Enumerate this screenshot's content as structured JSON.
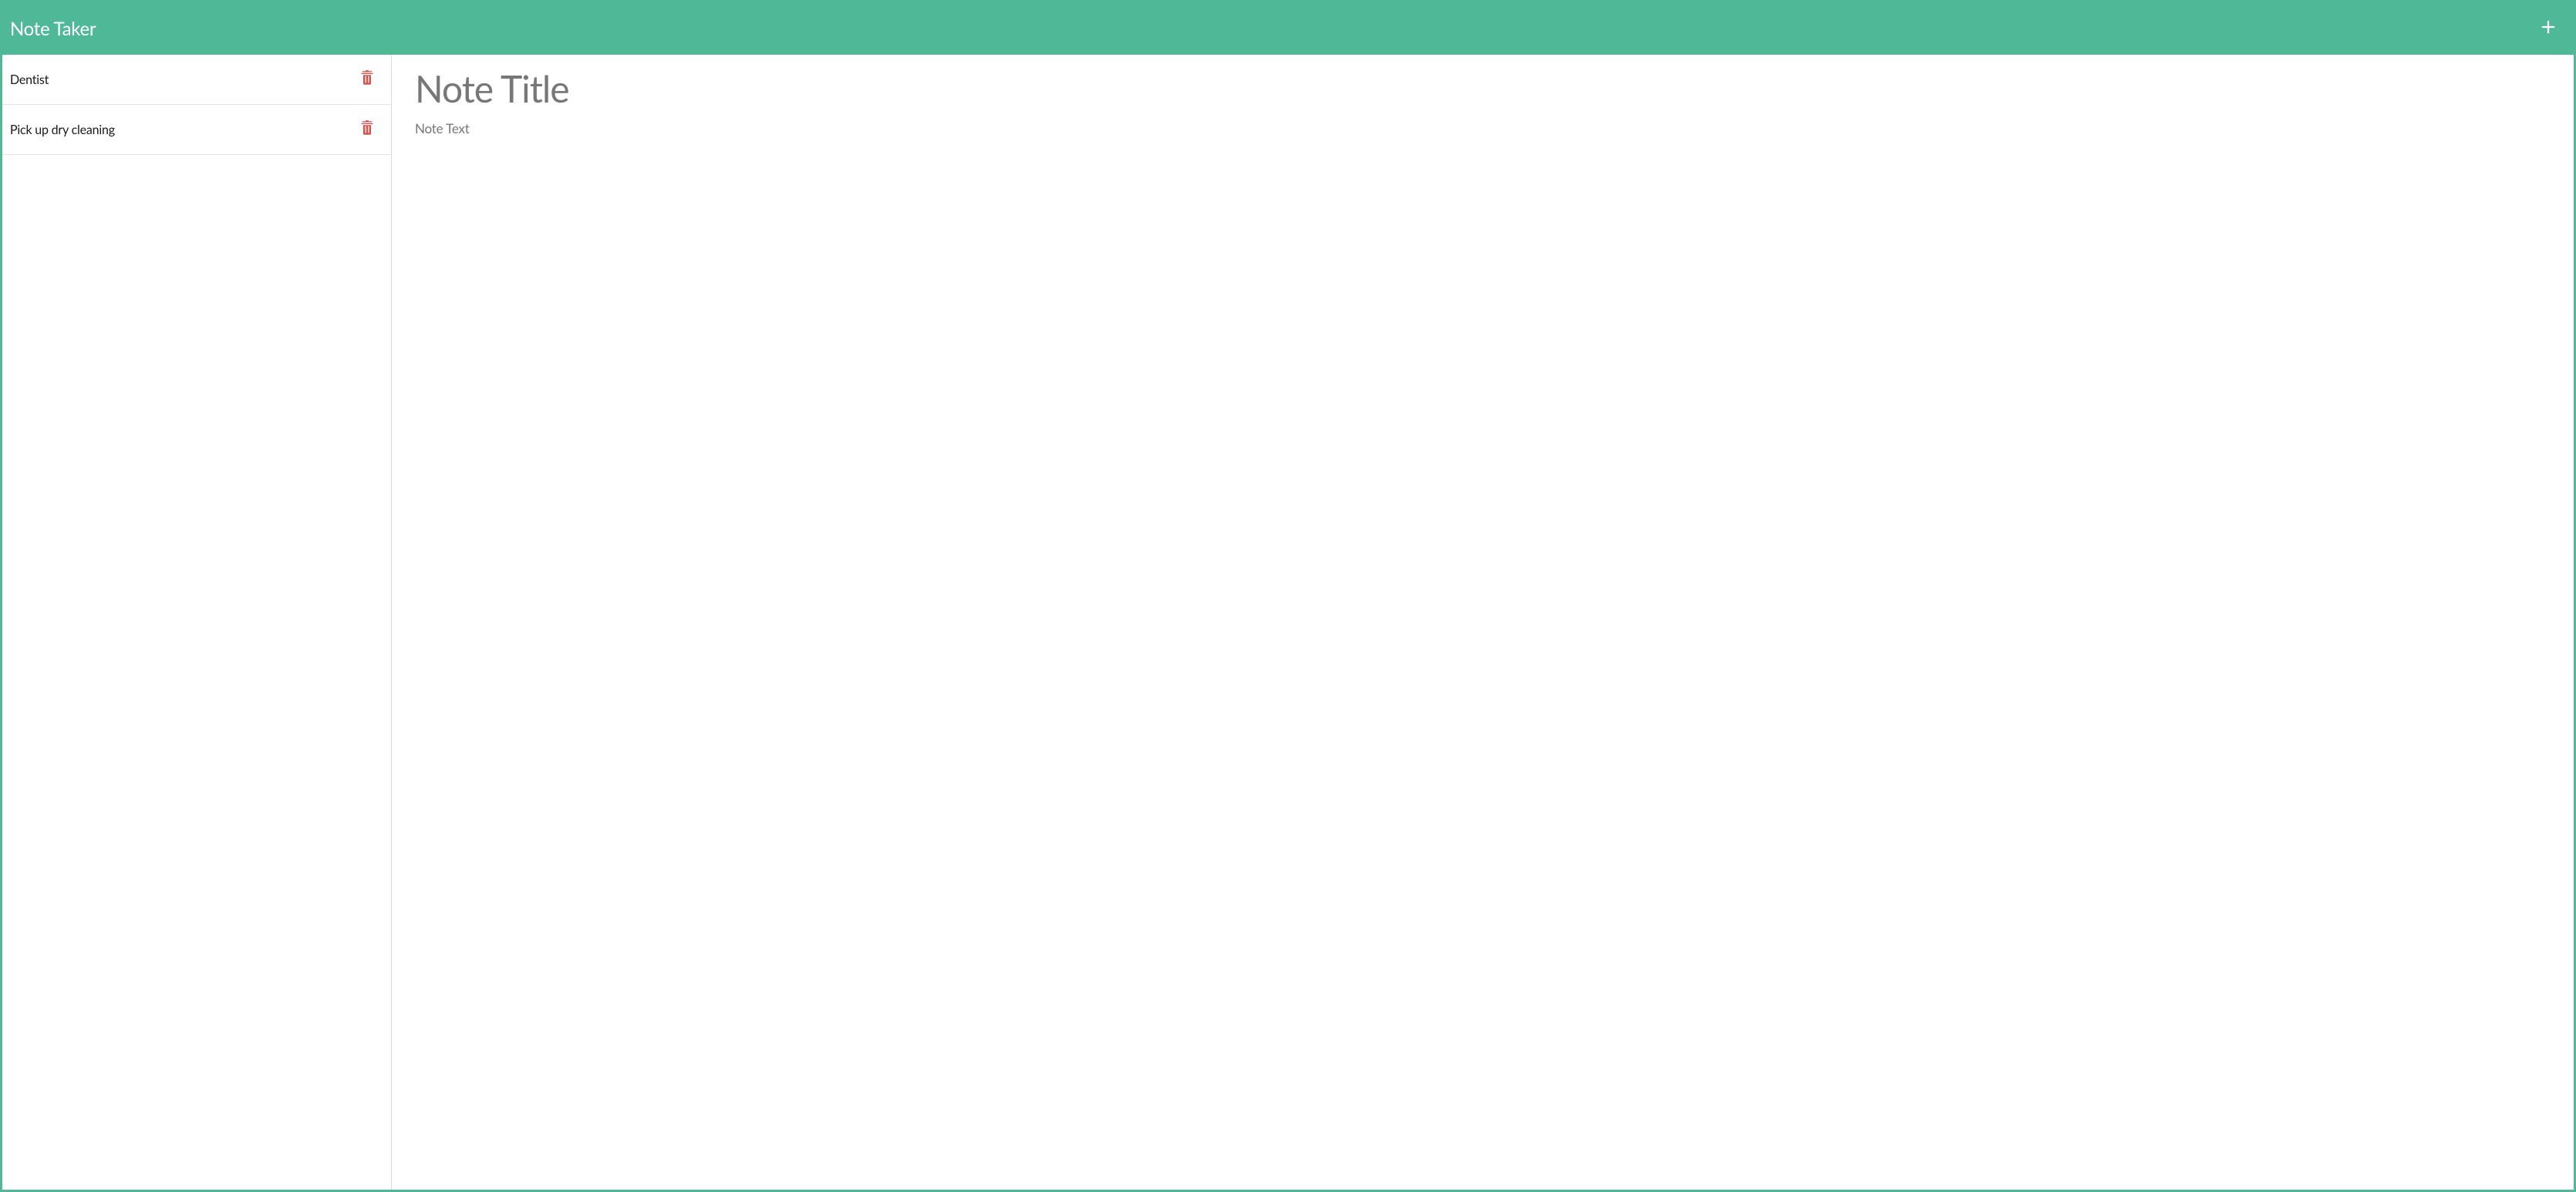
{
  "header": {
    "title": "Note Taker",
    "add_icon": "plus-icon"
  },
  "sidebar": {
    "notes": [
      {
        "title": "Dentist",
        "delete_icon": "trash-icon"
      },
      {
        "title": "Pick up dry cleaning",
        "delete_icon": "trash-icon"
      }
    ]
  },
  "editor": {
    "title_value": "",
    "title_placeholder": "Note Title",
    "body_value": "",
    "body_placeholder": "Note Text"
  },
  "colors": {
    "brand": "#4fb896",
    "danger": "#d9534f"
  }
}
